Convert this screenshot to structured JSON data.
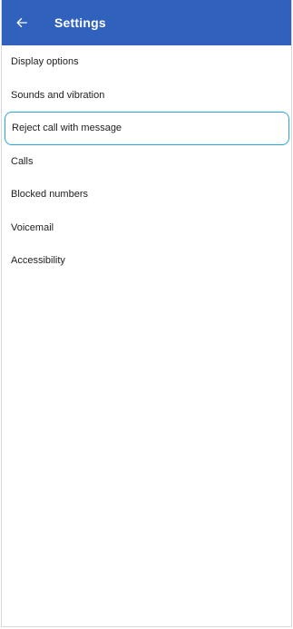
{
  "colors": {
    "accent": "#2f61bd",
    "focus": "#27a6e0"
  },
  "app_bar": {
    "title": "Settings",
    "back_icon": "arrow-back-icon"
  },
  "settings": {
    "items": [
      {
        "label": "Display options"
      },
      {
        "label": "Sounds and vibration"
      },
      {
        "label": "Reject call with message",
        "focused": true
      },
      {
        "label": "Calls"
      },
      {
        "label": "Blocked numbers"
      },
      {
        "label": "Voicemail"
      },
      {
        "label": "Accessibility"
      }
    ]
  }
}
